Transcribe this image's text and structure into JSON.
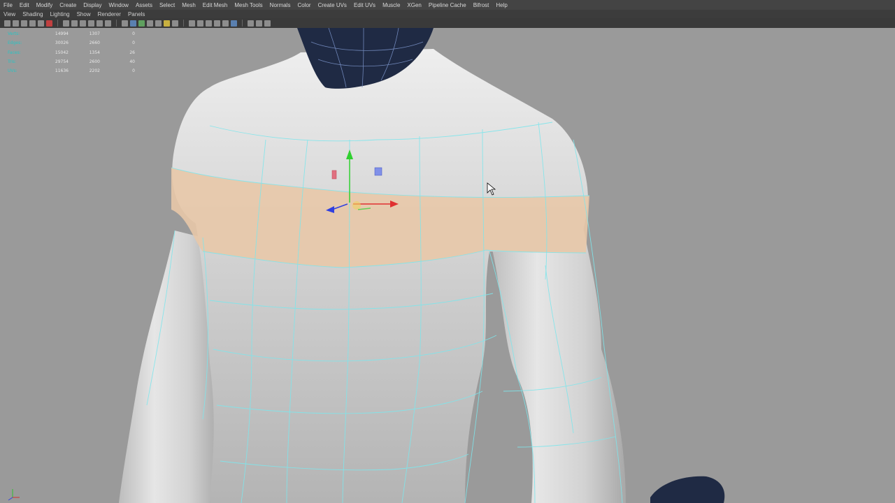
{
  "menu": [
    "File",
    "Edit",
    "Modify",
    "Create",
    "Display",
    "Window",
    "Assets",
    "Select",
    "Mesh",
    "Edit Mesh",
    "Mesh Tools",
    "Normals",
    "Color",
    "Create UVs",
    "Edit UVs",
    "Muscle",
    "XGen",
    "Pipeline Cache",
    "Bifrost",
    "Help"
  ],
  "panel_menu": [
    "View",
    "Shading",
    "Lighting",
    "Show",
    "Renderer",
    "Panels"
  ],
  "hud": [
    {
      "label": "Verts:",
      "a": "14994",
      "b": "1307",
      "c": "0"
    },
    {
      "label": "Edges:",
      "a": "30026",
      "b": "2660",
      "c": "0"
    },
    {
      "label": "Faces:",
      "a": "15042",
      "b": "1354",
      "c": "26"
    },
    {
      "label": "Tris:",
      "a": "29754",
      "b": "2600",
      "c": "40"
    },
    {
      "label": "UVs:",
      "a": "11636",
      "b": "2202",
      "c": "0"
    }
  ],
  "colors": {
    "viewport_bg": "#9a9a9a",
    "selection": "#e8c8a8",
    "wireframe": "#7ee6ec",
    "menubar": "#444444"
  }
}
